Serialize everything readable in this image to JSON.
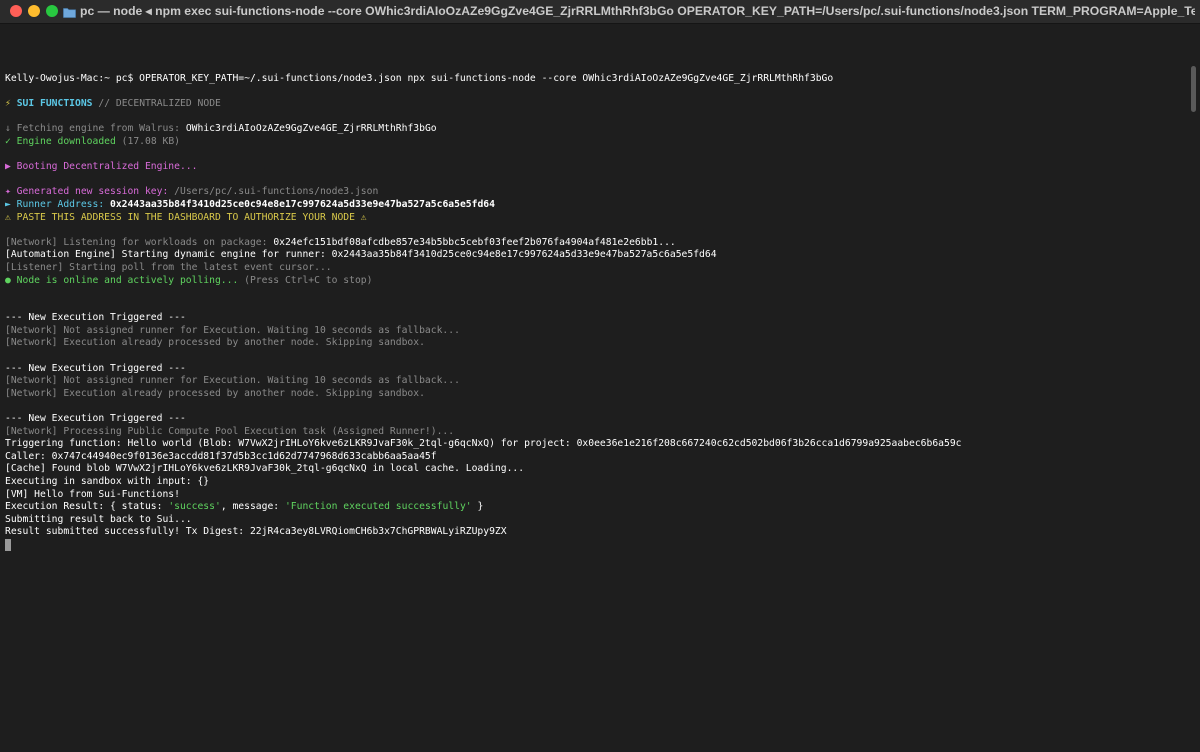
{
  "window": {
    "title": "pc — node ◂ npm exec sui-functions-node --core OWhic3rdiAIoOzAZe9GgZve4GE_ZjrRRLMthRhf3bGo OPERATOR_KEY_PATH=/Users/pc/.sui-functions/node3.json TERM_PROGRAM=Apple_Termi..."
  },
  "prompt": {
    "user_host": "Kelly-Owojus-Mac:~ pc$",
    "command": "OPERATOR_KEY_PATH=~/.sui-functions/node3.json npx sui-functions-node --core OWhic3rdiAIoOzAZe9GgZve4GE_ZjrRRLMthRhf3bGo"
  },
  "banner": {
    "icon": "⚡",
    "name": "SUI FUNCTIONS",
    "sep": "//",
    "tagline": "DECENTRALIZED NODE"
  },
  "engine": {
    "fetching_label": "↓ Fetching engine from Walrus:",
    "fetching_id": "OWhic3rdiAIoOzAZe9GgZve4GE_ZjrRRLMthRhf3bGo",
    "downloaded_label": "✓ Engine downloaded",
    "downloaded_size": "(17.08 KB)",
    "booting": "▶ Booting Decentralized Engine..."
  },
  "session": {
    "key_label": "✦ Generated new session key:",
    "key_path": "/Users/pc/.sui-functions/node3.json",
    "runner_label": "► Runner Address:",
    "runner_address": "0x2443aa35b84f3410d25ce0c94e8e17c997624a5d33e9e47ba527a5c6a5e5fd64",
    "warning": "⚠ PASTE THIS ADDRESS IN THE DASHBOARD TO AUTHORIZE YOUR NODE ⚠"
  },
  "network": {
    "listening_label": "[Network] Listening for workloads on package:",
    "package": "0x24efc151bdf08afcdbe857e34b5bbc5cebf03feef2b076fa4904af481e2e6bb1...",
    "automation": "[Automation Engine] Starting dynamic engine for runner: 0x2443aa35b84f3410d25ce0c94e8e17c997624a5d33e9e47ba527a5c6a5e5fd64",
    "listener": "[Listener] Starting poll from the latest event cursor...",
    "online": "● Node is online and actively polling...",
    "online_hint": "(Press Ctrl+C to stop)"
  },
  "executions": [
    {
      "header": "--- New Execution Triggered ---",
      "not_assigned": "[Network] Not assigned runner for Execution. Waiting 10 seconds as fallback...",
      "processed": "[Network] Execution already processed by another node. Skipping sandbox."
    },
    {
      "header": "--- New Execution Triggered ---",
      "not_assigned": "[Network] Not assigned runner for Execution. Waiting 10 seconds as fallback...",
      "processed": "[Network] Execution already processed by another node. Skipping sandbox."
    }
  ],
  "final_execution": {
    "header": "--- New Execution Triggered ---",
    "processing": "[Network] Processing Public Compute Pool Execution task (Assigned Runner!)...",
    "triggering": "Triggering function: Hello world (Blob: W7VwX2jrIHLoY6kve6zLKR9JvaF30k_2tql-g6qcNxQ) for project: 0x0ee36e1e216f208c667240c62cd502bd06f3b26cca1d6799a925aabec6b6a59c",
    "caller": "Caller: 0x747c44940ec9f0136e3accdd81f37d5b3cc1d62d7747968d633cabb6aa5aa45f",
    "cache": "[Cache] Found blob W7VwX2jrIHLoY6kve6zLKR9JvaF30k_2tql-g6qcNxQ in local cache. Loading...",
    "sandbox": "Executing in sandbox with input: {}",
    "vm": "[VM] Hello from Sui-Functions!",
    "result_prefix": "Execution Result: { status: ",
    "status_value": "'success'",
    "result_mid": ", message: ",
    "message_value": "'Function executed successfully'",
    "result_suffix": " }",
    "submitting": "Submitting result back to Sui...",
    "submitted": "Result submitted successfully! Tx Digest: 22jR4ca3ey8LVRQiomCH6b3x7ChGPRBWALyiRZUpy9ZX"
  }
}
